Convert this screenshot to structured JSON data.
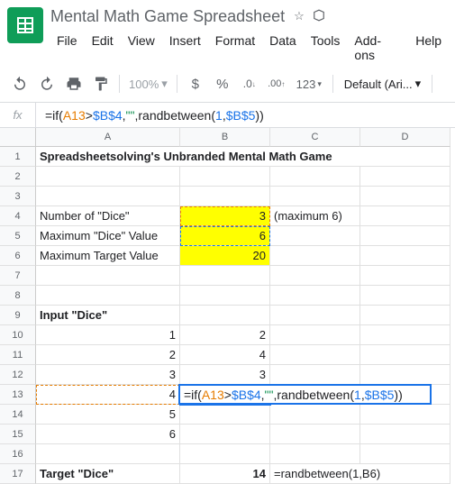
{
  "doc": {
    "title": "Mental Math Game Spreadsheet"
  },
  "menu": {
    "file": "File",
    "edit": "Edit",
    "view": "View",
    "insert": "Insert",
    "format": "Format",
    "data": "Data",
    "tools": "Tools",
    "addons": "Add-ons",
    "help": "Help"
  },
  "toolbar": {
    "zoom": "100%",
    "dollar": "$",
    "percent": "%",
    "dec_dec": ".0",
    "dec_inc": ".00",
    "num_fmt": "123",
    "font": "Default (Ari..."
  },
  "formula": {
    "raw": "=if(A13>$B$4,\"\",randbetween(1,$B$5))",
    "p1": "=if(",
    "ref1": "A13",
    "p2": ">",
    "ref2": "$B$4",
    "p3": ",",
    "str": "\"\"",
    "p4": ",randbetween(",
    "num": "1",
    "p5": ",",
    "ref3": "$B$5",
    "p6": "))"
  },
  "cols": {
    "a": "A",
    "b": "B",
    "c": "C",
    "d": "D"
  },
  "rows": {
    "r1": {
      "a": "Spreadsheetsolving's Unbranded Mental Math Game"
    },
    "r4": {
      "a": "Number of \"Dice\"",
      "b": "3",
      "c": "(maximum 6)"
    },
    "r5": {
      "a": "Maximum \"Dice\" Value",
      "b": "6"
    },
    "r6": {
      "a": "Maximum Target Value",
      "b": "20"
    },
    "r9": {
      "a": "Input \"Dice\""
    },
    "r10": {
      "a": "1",
      "b": "2"
    },
    "r11": {
      "a": "2",
      "b": "4"
    },
    "r12": {
      "a": "3",
      "b": "3"
    },
    "r13": {
      "a": "4"
    },
    "r14": {
      "a": "5"
    },
    "r15": {
      "a": "6"
    },
    "r17": {
      "a": "Target \"Dice\"",
      "b": "14",
      "c": "=randbetween(1,B6)"
    }
  },
  "rownums": {
    "1": "1",
    "2": "2",
    "3": "3",
    "4": "4",
    "5": "5",
    "6": "6",
    "7": "7",
    "8": "8",
    "9": "9",
    "10": "10",
    "11": "11",
    "12": "12",
    "13": "13",
    "14": "14",
    "15": "15",
    "16": "16",
    "17": "17"
  }
}
